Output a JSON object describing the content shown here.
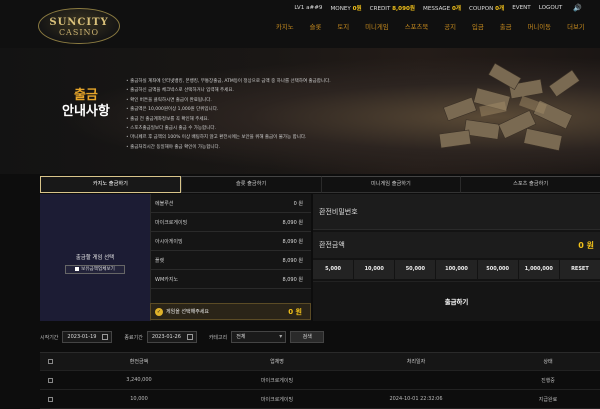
{
  "brand": {
    "line1": "SUNCITY",
    "line2": "CASINO"
  },
  "topbar": {
    "level_label": "LV1",
    "username": "a##9",
    "money_label": "MONEY",
    "money_value": "0원",
    "credit_label": "CREDIT",
    "credit_value": "8,090원",
    "message_label": "MESSAGE",
    "message_value": "0개",
    "coupon_label": "COUPON",
    "coupon_value": "0개",
    "event": "EVENT",
    "logout": "LOGOUT"
  },
  "nav": [
    "카지노",
    "슬롯",
    "토지",
    "미니게임",
    "스포츠북",
    "공지",
    "입금",
    "출금",
    "머니이동",
    "더보기"
  ],
  "nav_active": 7,
  "banner": {
    "title1": "출금",
    "title2": "안내사항",
    "notices": [
      "출금하실 계좌에 인터넷뱅킹, 폰뱅킹, 무통장출금, ATM등이 정상으로 금액 중 하나를 선택하여 출금합니다.",
      "출금하신 금액을 체크박스로 선택하거나 입력해 주세요.",
      "확인 버튼을 클릭하시면 출금이 완료됩니다.",
      "출금액은 10,000원이상 1,000원 단위입니다.",
      "출금 전 출금계좌정보를 꼭 확인해 주세요.",
      "스포츠출금일보다 출금시 출금 수 가능합니다.",
      "마니페르 후 금액의 100% 이상 배팅하지 않고 환전시에는 보안을 위해 출금이 불가능 합니다.",
      "출금처리시간 동일해야 출금 확인이 가능합니다."
    ]
  },
  "tabs": [
    "카지노 출금하기",
    "슬롯 출금하기",
    "미니게임 출금하기",
    "스포츠 출금하기"
  ],
  "tabs_active": 0,
  "left": {
    "title": "출금할 게임 선택",
    "show_all": "보유금액업체보기"
  },
  "games": [
    {
      "name": "에볼루션",
      "amount": "0 원"
    },
    {
      "name": "마이크로게이밍",
      "amount": "8,090 원"
    },
    {
      "name": "아시아게이밍",
      "amount": "8,090 원"
    },
    {
      "name": "플렛",
      "amount": "8,090 원"
    },
    {
      "name": "WM카지노",
      "amount": "8,090 원"
    },
    {
      "name": "",
      "amount": ""
    }
  ],
  "total": {
    "label": "게임을 선택해주세요",
    "value": "0 원"
  },
  "right": {
    "password_label": "환전비밀번호",
    "amount_label": "환전금액",
    "amount_value": "0 원",
    "quick": [
      "5,000",
      "10,000",
      "50,000",
      "100,000",
      "500,000",
      "1,000,000",
      "RESET"
    ],
    "withdraw": "출금하기"
  },
  "filter": {
    "start_label": "시작기간",
    "start_date": "2023-01-19",
    "end_label": "종료기간",
    "end_date": "2023-01-26",
    "cat_label": "카테고리",
    "cat_value": "전체",
    "search": "검색"
  },
  "table": {
    "headers": [
      "환전금액",
      "업체명",
      "처리일자",
      "상태"
    ],
    "rows": [
      [
        "3,240,000",
        "마이크로게이밍",
        "",
        "진행중"
      ],
      [
        "10,000",
        "마이크로게이밍",
        "2024-10-01 22:32:06",
        "지급완료"
      ]
    ]
  },
  "colors": {
    "accent": "#f3c21a",
    "nav": "#c58a1e",
    "panel": "#1c1c34"
  }
}
